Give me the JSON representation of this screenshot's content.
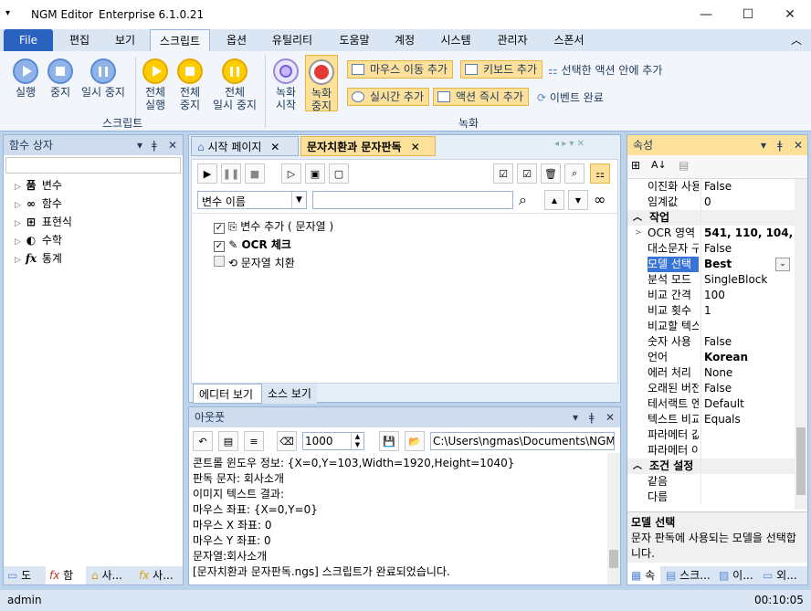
{
  "title": {
    "app": "NGM Editor",
    "edition": "Enterprise 6.1.0.21"
  },
  "menu": {
    "file": "File",
    "items": [
      "편집",
      "보기",
      "스크립트",
      "옵션",
      "유틸리티",
      "도움말",
      "계정",
      "시스템",
      "관리자",
      "스폰서"
    ]
  },
  "ribbon": {
    "run": "실행",
    "stop": "중지",
    "pause": "일시 중지",
    "all_run": [
      "전체",
      "실행"
    ],
    "all_stop": [
      "전체",
      "중지"
    ],
    "all_pause": [
      "전체",
      "일시 중지"
    ],
    "group_script": "스크립트",
    "rec_start": [
      "녹화",
      "시작"
    ],
    "rec_stop": [
      "녹화",
      "중지"
    ],
    "mouse_add": "마우스 이동 추가",
    "key_add": "키보드 추가",
    "inside_action": "선택한 액션 안에 추가",
    "realtime_add": "실시간 추가",
    "action_now": "액션 즉시 추가",
    "event_done": "이벤트 완료",
    "group_rec": "녹화"
  },
  "left_panel": {
    "title": "함수 상자",
    "items": [
      {
        "icon": "품",
        "label": "변수"
      },
      {
        "icon": "∞",
        "label": "함수"
      },
      {
        "icon": "⊞",
        "label": "표현식"
      },
      {
        "icon": "◐",
        "label": "수학"
      },
      {
        "icon": "fx",
        "label": "통계"
      }
    ],
    "bottom_tabs": [
      "도",
      "함",
      "사...",
      "사..."
    ]
  },
  "doc_tabs": {
    "start": "시작 페이지",
    "active": "문자치환과 문자판독"
  },
  "editor": {
    "var_select": "변수 이름",
    "search_value": "",
    "actions": [
      {
        "label": "변수 추가 ( 문자열 )",
        "bold": false,
        "checked": true
      },
      {
        "label": "OCR 체크",
        "bold": true,
        "checked": true
      },
      {
        "label": "문자열 치환",
        "bold": false,
        "checked": false
      }
    ],
    "tab_editor": "에디터 보기",
    "tab_source": "소스 보기"
  },
  "output": {
    "title": "아웃풋",
    "count": "1000",
    "path": "C:\\Users\\ngmas\\Documents\\NGM6\\",
    "lines": [
      "콘트롤 윈도우 정보: {X=0,Y=103,Width=1920,Height=1040}",
      "판독 문자: 회사소개",
      "이미지 텍스트 결과:",
      "마우스 좌표: {X=0,Y=0}",
      "마우스 X 좌표: 0",
      "마우스 Y 좌표: 0",
      "문자열:회사소개",
      "[문자치환과 문자판독.ngs] 스크립트가 완료되었습니다."
    ]
  },
  "props": {
    "title": "속성",
    "rows": [
      {
        "n": "이진화 사용",
        "v": "False",
        "cat": false,
        "bold": false
      },
      {
        "n": "임계값",
        "v": "0",
        "cat": false,
        "bold": false
      },
      {
        "n": "작업",
        "v": "",
        "cat": true,
        "bold": false
      },
      {
        "n": "OCR 영역",
        "v": "541, 110, 104, 4",
        "cat": false,
        "bold": true
      },
      {
        "n": "대소문자 구분",
        "v": "False",
        "cat": false,
        "bold": false
      },
      {
        "n": "모델 선택",
        "v": "Best",
        "cat": false,
        "bold": true,
        "selected": true
      },
      {
        "n": "분석 모드",
        "v": "SingleBlock",
        "cat": false,
        "bold": false
      },
      {
        "n": "비교 간격",
        "v": "100",
        "cat": false,
        "bold": false
      },
      {
        "n": "비교 횟수",
        "v": "1",
        "cat": false,
        "bold": false
      },
      {
        "n": "비교할 텍스트",
        "v": "",
        "cat": false,
        "bold": false
      },
      {
        "n": "숫자 사용",
        "v": "False",
        "cat": false,
        "bold": false
      },
      {
        "n": "언어",
        "v": "Korean",
        "cat": false,
        "bold": true
      },
      {
        "n": "에러 처리",
        "v": "None",
        "cat": false,
        "bold": false
      },
      {
        "n": "오래된 버전",
        "v": "False",
        "cat": false,
        "bold": false
      },
      {
        "n": "테서랙트 엔진",
        "v": "Default",
        "cat": false,
        "bold": false
      },
      {
        "n": "텍스트 비교",
        "v": "Equals",
        "cat": false,
        "bold": false
      },
      {
        "n": "파라메터 값",
        "v": "",
        "cat": false,
        "bold": false
      },
      {
        "n": "파라메터 이름",
        "v": "",
        "cat": false,
        "bold": false
      },
      {
        "n": "조건 설정",
        "v": "",
        "cat": true,
        "bold": false
      },
      {
        "n": "같음",
        "v": "",
        "cat": false,
        "bold": false
      },
      {
        "n": "다름",
        "v": "",
        "cat": false,
        "bold": false
      }
    ],
    "desc_title": "모델 선택",
    "desc_text": "문자 판독에 사용되는 모델을 선택합니다.",
    "bottom_tabs": [
      "속",
      "스크...",
      "이...",
      "외..."
    ]
  },
  "status": {
    "user": "admin",
    "time": "00:10:05"
  }
}
